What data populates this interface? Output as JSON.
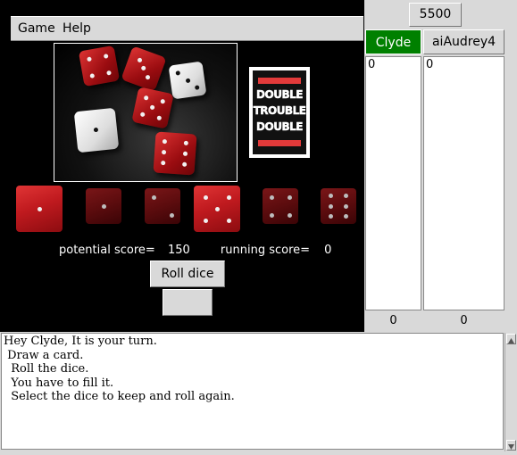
{
  "menu": {
    "items": [
      "Game",
      "Help"
    ]
  },
  "card": {
    "words": [
      "DOUBLE",
      "TROUBLE",
      "DOUBLE"
    ]
  },
  "dice": [
    {
      "value": 1,
      "kept": false
    },
    {
      "value": 1,
      "kept": true
    },
    {
      "value": 2,
      "kept": true
    },
    {
      "value": 5,
      "kept": false
    },
    {
      "value": 4,
      "kept": true
    },
    {
      "value": 6,
      "kept": true
    }
  ],
  "scores": {
    "potential_label": "potential score=",
    "potential_value": "150",
    "running_label": "running score=",
    "running_value": "0"
  },
  "buttons": {
    "roll": "Roll dice",
    "secondary": ""
  },
  "scoreboard": {
    "target": "5500",
    "players": [
      {
        "name": "Clyde",
        "active": true,
        "entries": [
          "0"
        ],
        "total": "0"
      },
      {
        "name": "aiAudrey4",
        "active": false,
        "entries": [
          "0"
        ],
        "total": "0"
      }
    ]
  },
  "log": {
    "lines": [
      "Hey Clyde, It is your turn.",
      " Draw a card.",
      "  Roll the dice.",
      "  You have to fill it.",
      "  Select the dice to keep and roll again."
    ]
  },
  "colors": {
    "active_player": "#008000",
    "die_red": "#c01a1f"
  }
}
